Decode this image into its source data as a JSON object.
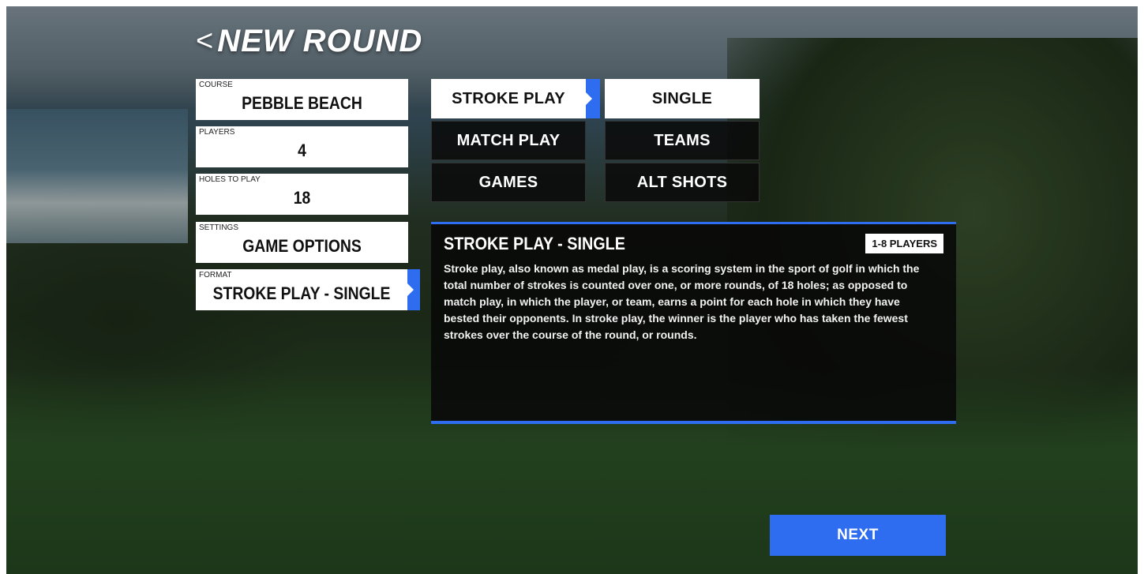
{
  "header": {
    "back_glyph": "<",
    "title": "NEW ROUND"
  },
  "settings": {
    "course": {
      "label": "COURSE",
      "value": "PEBBLE BEACH"
    },
    "players": {
      "label": "PLAYERS",
      "value": "4"
    },
    "holes": {
      "label": "HOLES TO PLAY",
      "value": "18"
    },
    "options": {
      "label": "SETTINGS",
      "value": "GAME OPTIONS"
    },
    "format": {
      "label": "FORMAT",
      "value": "STROKE PLAY - SINGLE"
    }
  },
  "modes": [
    "STROKE PLAY",
    "MATCH PLAY",
    "GAMES"
  ],
  "variants": [
    "SINGLE",
    "TEAMS",
    "ALT SHOTS"
  ],
  "selected": {
    "mode": "STROKE PLAY",
    "variant": "SINGLE"
  },
  "description": {
    "title": "STROKE PLAY - SINGLE",
    "badge": "1-8 PLAYERS",
    "body": "Stroke play, also known as medal play, is a scoring system in the sport of golf in which the total number of strokes is counted over one, or more rounds, of 18 holes; as opposed to match play, in which the player, or team, earns a point for each hole in which they have bested their opponents. In stroke play, the winner is the player who has taken the fewest strokes over the course of the round, or rounds."
  },
  "next_button": {
    "label": "NEXT"
  },
  "colors": {
    "accent": "#2f6df0",
    "panel": "#0a0a0a",
    "field": "#ffffff"
  }
}
